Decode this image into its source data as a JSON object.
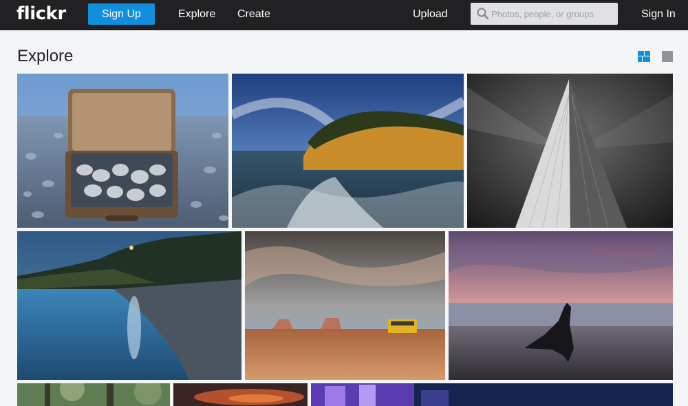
{
  "header": {
    "logo": "flickr",
    "signup_label": "Sign Up",
    "nav": {
      "explore": "Explore",
      "create": "Create",
      "upload": "Upload",
      "signin": "Sign In"
    },
    "search_placeholder": "Photos, people, or groups"
  },
  "page": {
    "title": "Explore",
    "view_modes": [
      "grid-view-icon",
      "single-view-icon"
    ],
    "accent_color": "#128fdc"
  },
  "photos": [
    {
      "subject": "suitcase filled with beach pebbles"
    },
    {
      "subject": "golden cliff over crashing waves"
    },
    {
      "subject": "black and white skyscraper"
    },
    {
      "subject": "blue coastline at dusk"
    },
    {
      "subject": "desert road with yellow bus"
    },
    {
      "subject": "woman with flowing dress at beach sunset"
    },
    {
      "subject": "forest trees"
    },
    {
      "subject": "orange sunset sky"
    },
    {
      "subject": "purple lit building at night"
    }
  ]
}
